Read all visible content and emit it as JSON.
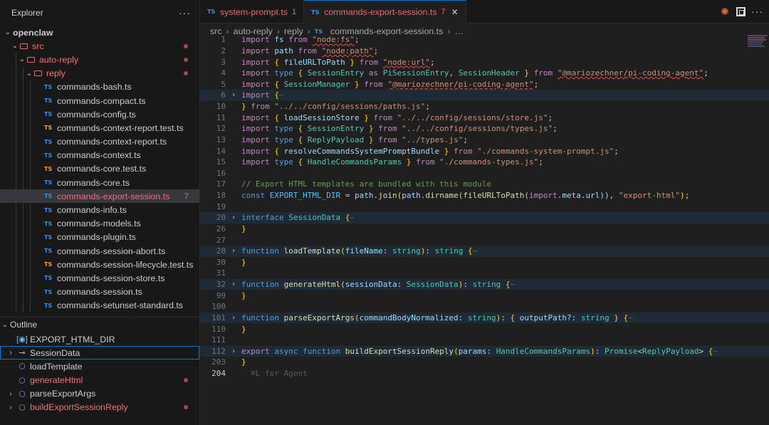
{
  "explorer": {
    "title": "Explorer",
    "more": "···",
    "tree": [
      {
        "label": "openclaw",
        "depth": 0,
        "kind": "root"
      },
      {
        "label": "src",
        "depth": 1,
        "kind": "folder",
        "red": true,
        "dot": true
      },
      {
        "label": "auto-reply",
        "depth": 2,
        "kind": "folder",
        "red": true,
        "dot": true
      },
      {
        "label": "reply",
        "depth": 3,
        "kind": "folder",
        "red": true,
        "dot": true
      },
      {
        "label": "commands-bash.ts",
        "depth": 4,
        "kind": "ts"
      },
      {
        "label": "commands-compact.ts",
        "depth": 4,
        "kind": "ts"
      },
      {
        "label": "commands-config.ts",
        "depth": 4,
        "kind": "ts"
      },
      {
        "label": "commands-context-report.test.ts",
        "depth": 4,
        "kind": "ts-test"
      },
      {
        "label": "commands-context-report.ts",
        "depth": 4,
        "kind": "ts"
      },
      {
        "label": "commands-context.ts",
        "depth": 4,
        "kind": "ts"
      },
      {
        "label": "commands-core.test.ts",
        "depth": 4,
        "kind": "ts-test"
      },
      {
        "label": "commands-core.ts",
        "depth": 4,
        "kind": "ts"
      },
      {
        "label": "commands-export-session.ts",
        "depth": 4,
        "kind": "ts",
        "selected": true,
        "red": true,
        "badge": "7"
      },
      {
        "label": "commands-info.ts",
        "depth": 4,
        "kind": "ts"
      },
      {
        "label": "commands-models.ts",
        "depth": 4,
        "kind": "ts"
      },
      {
        "label": "commands-plugin.ts",
        "depth": 4,
        "kind": "ts"
      },
      {
        "label": "commands-session-abort.ts",
        "depth": 4,
        "kind": "ts"
      },
      {
        "label": "commands-session-lifecycle.test.ts",
        "depth": 4,
        "kind": "ts-test"
      },
      {
        "label": "commands-session-store.ts",
        "depth": 4,
        "kind": "ts"
      },
      {
        "label": "commands-session.ts",
        "depth": 4,
        "kind": "ts"
      },
      {
        "label": "commands-setunset-standard.ts",
        "depth": 4,
        "kind": "ts"
      }
    ]
  },
  "outline": {
    "title": "Outline",
    "items": [
      {
        "label": "EXPORT_HTML_DIR",
        "icon": "constant-icon",
        "glyph": "[◉]",
        "cls": "const",
        "chev": ""
      },
      {
        "label": "SessionData",
        "icon": "interface-icon",
        "glyph": "⊸",
        "cls": "iface",
        "chev": "›",
        "focused": true
      },
      {
        "label": "loadTemplate",
        "icon": "function-icon",
        "glyph": "⬡",
        "cls": "fn",
        "chev": ""
      },
      {
        "label": "generateHtml",
        "icon": "function-icon",
        "glyph": "⬡",
        "cls": "fn",
        "chev": "",
        "red": true,
        "dot": true
      },
      {
        "label": "parseExportArgs",
        "icon": "function-icon",
        "glyph": "⬡",
        "cls": "fn",
        "chev": "›"
      },
      {
        "label": "buildExportSessionReply",
        "icon": "function-icon",
        "glyph": "⬡",
        "cls": "fn",
        "chev": "›",
        "red": true,
        "dot": true
      }
    ]
  },
  "tabs": [
    {
      "icon": "TS",
      "label": "system-prompt.ts",
      "badge": "1",
      "active": false
    },
    {
      "icon": "TS",
      "label": "commands-export-session.ts",
      "badge": "7",
      "active": true,
      "close": "✕"
    }
  ],
  "breadcrumb": [
    "src",
    "auto-reply",
    "reply",
    "TS",
    "commands-export-session.ts",
    "…"
  ],
  "code": [
    {
      "n": "1",
      "html": "<span class='kc'>import</span> <span class='v'>fs</span> <span class='kc'>from</span> <span class='sq'>\"node:fs\"</span>;"
    },
    {
      "n": "2",
      "html": "<span class='kc'>import</span> <span class='v'>path</span> <span class='kc'>from</span> <span class='sq'>\"node:path\"</span>;"
    },
    {
      "n": "3",
      "html": "<span class='kc'>import</span> <span class='b'>{</span> <span class='v'>fileURLToPath</span> <span class='b'>}</span> <span class='kc'>from</span> <span class='sq'>\"node:url\"</span>;"
    },
    {
      "n": "4",
      "html": "<span class='kc'>import</span> <span class='k'>type</span> <span class='b'>{</span> <span class='t'>SessionEntry</span> <span class='kc'>as</span> <span class='t'>PiSessionEntry</span>, <span class='t'>SessionHeader</span> <span class='b'>}</span> <span class='kc'>from</span> <span class='sq'>\"@mariozechner/pi-coding-agent\"</span>;"
    },
    {
      "n": "5",
      "html": "<span class='kc'>import</span> <span class='b'>{</span> <span class='t'>SessionManager</span> <span class='b'>}</span> <span class='kc'>from</span> <span class='sq'>\"@mariozechner/pi-coding-agent\"</span>;"
    },
    {
      "n": "6",
      "fold": "›",
      "hl": true,
      "html": "<span class='kc'>import</span> <span class='b'>{</span><span class='ghost'>⋯</span>"
    },
    {
      "n": "10",
      "html": "<span class='b'>}</span> <span class='kc'>from</span> <span class='s'>\"../../config/sessions/paths.js\"</span>;"
    },
    {
      "n": "11",
      "html": "<span class='kc'>import</span> <span class='b'>{</span> <span class='v'>loadSessionStore</span> <span class='b'>}</span> <span class='kc'>from</span> <span class='s'>\"../../config/sessions/store.js\"</span>;"
    },
    {
      "n": "12",
      "html": "<span class='kc'>import</span> <span class='k'>type</span> <span class='b'>{</span> <span class='t'>SessionEntry</span> <span class='b'>}</span> <span class='kc'>from</span> <span class='s'>\"../../config/sessions/types.js\"</span>;"
    },
    {
      "n": "13",
      "html": "<span class='kc'>import</span> <span class='k'>type</span> <span class='b'>{</span> <span class='t'>ReplyPayload</span> <span class='b'>}</span> <span class='kc'>from</span> <span class='s'>\"../types.js\"</span>;"
    },
    {
      "n": "14",
      "html": "<span class='kc'>import</span> <span class='b'>{</span> <span class='v'>resolveCommandsSystemPromptBundle</span> <span class='b'>}</span> <span class='kc'>from</span> <span class='s'>\"./commands-system-prompt.js\"</span>;"
    },
    {
      "n": "15",
      "html": "<span class='kc'>import</span> <span class='k'>type</span> <span class='b'>{</span> <span class='t'>HandleCommandsParams</span> <span class='b'>}</span> <span class='kc'>from</span> <span class='s'>\"./commands-types.js\"</span>;"
    },
    {
      "n": "16",
      "html": ""
    },
    {
      "n": "17",
      "html": "<span class='c'>// Export HTML templates are bundled with this module</span>"
    },
    {
      "n": "18",
      "html": "<span class='k'>const</span> <span class='cn'>EXPORT_HTML_DIR</span> = <span class='v'>path</span>.<span class='f'>join</span><span class='b'>(</span><span class='v'>path</span>.<span class='f'>dirname</span>(<span class='f'>fileURLToPath</span>(<span class='kc'>import</span>.<span class='v'>meta</span>.<span class='v'>url</span>)), <span class='s'>\"export-html\"</span><span class='b'>)</span>;"
    },
    {
      "n": "19",
      "html": ""
    },
    {
      "n": "20",
      "fold": "›",
      "hl": true,
      "html": "<span class='k'>interface</span> <span class='t'>SessionData</span> <span class='b'>{</span><span class='ghost'>⋯</span>"
    },
    {
      "n": "26",
      "html": "<span class='b'>}</span>"
    },
    {
      "n": "27",
      "html": ""
    },
    {
      "n": "28",
      "fold": "›",
      "hl": true,
      "html": "<span class='k'>function</span> <span class='f'>loadTemplate</span><span class='b'>(</span><span class='v'>fileName</span>: <span class='t'>string</span><span class='b'>)</span>: <span class='t'>string</span> <span class='b'>{</span><span class='ghost'>⋯</span>"
    },
    {
      "n": "30",
      "html": "<span class='b'>}</span>"
    },
    {
      "n": "31",
      "html": ""
    },
    {
      "n": "32",
      "fold": "›",
      "hl": true,
      "html": "<span class='k'>function</span> <span class='f'>generateHtml</span><span class='b'>(</span><span class='v'>sessionData</span>: <span class='t'>SessionData</span><span class='b'>)</span>: <span class='t'>string</span> <span class='b'>{</span><span class='ghost'>⋯</span>"
    },
    {
      "n": "99",
      "html": "<span class='b'>}</span>"
    },
    {
      "n": "100",
      "html": ""
    },
    {
      "n": "101",
      "fold": "›",
      "hl": true,
      "html": "<span class='k'>function</span> <span class='f'>parseExportArgs</span><span class='b'>(</span><span class='v'>commandBodyNormalized</span>: <span class='t'>string</span><span class='b'>)</span>: <span class='b'>{</span> <span class='v'>outputPath?</span>: <span class='t'>string</span> <span class='b'>}</span> <span class='b'>{</span><span class='ghost'>⋯</span>"
    },
    {
      "n": "110",
      "html": "<span class='b'>}</span>"
    },
    {
      "n": "111",
      "html": ""
    },
    {
      "n": "112",
      "fold": "›",
      "hl": true,
      "html": "<span class='kc'>export</span> <span class='k'>async</span> <span class='k'>function</span> <span class='f'>buildExportSessionReply</span><span class='b'>(</span><span class='v'>params</span>: <span class='t'>HandleCommandsParams</span><span class='b'>)</span>: <span class='t'>Promise</span>&lt;<span class='t'>ReplyPayload</span>&gt; <span class='b'>{</span><span class='ghost'>⋯</span>"
    },
    {
      "n": "203",
      "html": "<span class='b'>}</span>"
    },
    {
      "n": "204",
      "cur": true,
      "html": "<span class='ghost'>  ⌘L for Agent</span>"
    }
  ],
  "colors": {
    "accent": "#0078d4",
    "error": "#e06c75",
    "folder_red": "#f07178"
  }
}
